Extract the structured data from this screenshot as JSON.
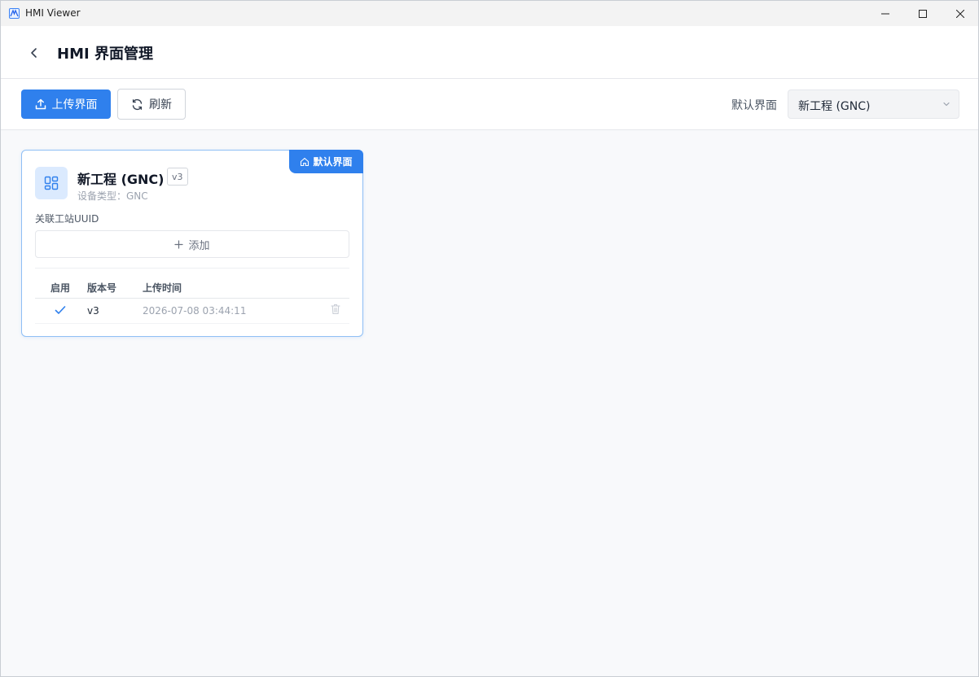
{
  "window": {
    "title": "HMI Viewer"
  },
  "header": {
    "title": "HMI 界面管理",
    "back_icon": "chevron-left-icon"
  },
  "toolbar": {
    "upload_label": "上传界面",
    "refresh_label": "刷新",
    "default_label": "默认界面",
    "default_select_value": "新工程 (GNC)"
  },
  "card": {
    "badge_label": "默认界面",
    "title": "新工程 (GNC)",
    "version_tag": "v3",
    "device_type": "设备类型：GNC",
    "uuid_label": "关联工站UUID",
    "add_label": "添加",
    "table": {
      "headers": [
        "启用",
        "版本号",
        "上传时间"
      ],
      "rows": [
        {
          "enabled": true,
          "version": "v3",
          "upload_time": "2026-07-08 03:44:11"
        }
      ]
    }
  },
  "colors": {
    "primary": "#2f80ed",
    "card_border": "#8fbff5",
    "background": "#f8f9fb"
  }
}
